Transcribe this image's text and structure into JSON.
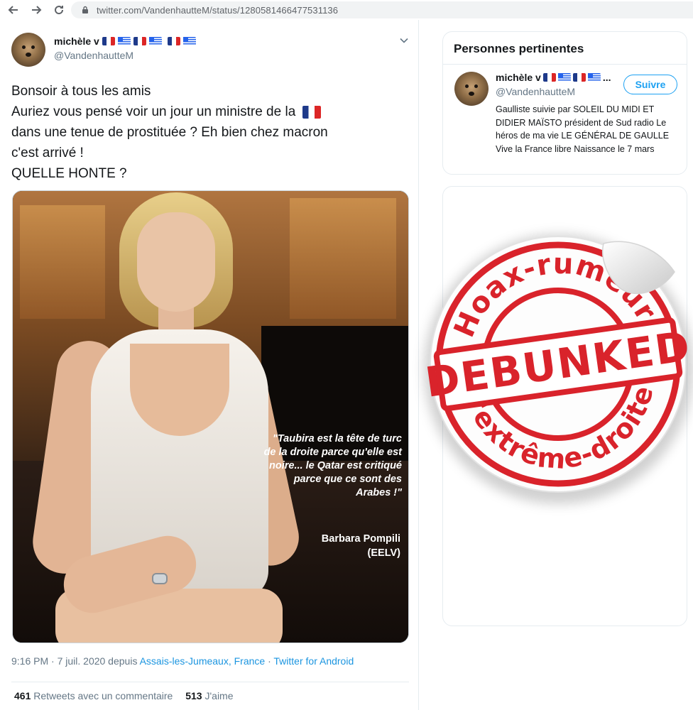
{
  "browser": {
    "url": "twitter.com/VandenhautteM/status/1280581466477531136"
  },
  "tweet": {
    "author_name": "michèle v",
    "author_handle": "@VandenhautteM",
    "text_lines": [
      "Bonsoir à tous les amis",
      "Auriez vous pensé  voir un jour un ministre de la",
      "dans une tenue de prostituée ? Eh bien chez macron",
      "c'est arrivé !",
      "QUELLE HONTE ?"
    ],
    "image_quote": "\"Taubira est la tête de turc de la droite parce qu'elle est noire... le Qatar est critiqué parce que ce sont des Arabes !\"",
    "image_author": "Barbara Pompili",
    "image_author_party": "(EELV)",
    "time": "9:16 PM · 7 juil. 2020 depuis",
    "location": "Assais-les-Jumeaux, France",
    "separator": "·",
    "source": "Twitter for Android",
    "retweets_count": "461",
    "retweets_label": "Retweets avec un commentaire",
    "likes_count": "513",
    "likes_label": "J'aime"
  },
  "sidebar": {
    "relevant_title": "Personnes pertinentes",
    "user_name": "michèle v",
    "user_name_suffix": "...",
    "user_handle": "@VandenhautteM",
    "follow_label": "Suivre",
    "bio": "Gaulliste suivie par SOLEIL DU MIDI ET DIDIER MAÏSTO président de Sud radio Le héros de ma vie LE GÉNÉRAL DE GAULLE Vive la France libre Naissance le 7 mars"
  },
  "sticker": {
    "top_text": "Hoax-rumeurs",
    "center_text": "DEBUNKED",
    "bottom_text": "d'extrême-droite",
    "accent_color": "#d9232b"
  },
  "colors": {
    "link": "#1b95e0",
    "follow": "#1da1f2",
    "muted": "#657786"
  },
  "icons": {
    "back": "arrow-left-icon",
    "forward": "arrow-right-icon",
    "reload": "reload-icon",
    "lock": "lock-icon",
    "chevron": "chevron-down-icon"
  }
}
